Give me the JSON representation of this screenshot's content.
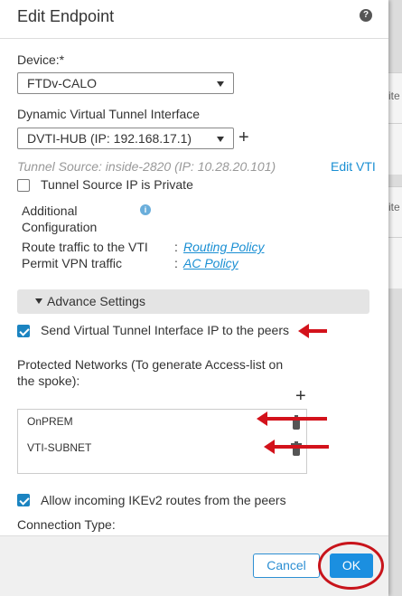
{
  "background": {
    "text_1": "ite",
    "text_2": "ite"
  },
  "dialog": {
    "title": "Edit Endpoint",
    "help_icon": "help-icon",
    "device": {
      "label": "Device:*",
      "value": "FTDv-CALO"
    },
    "dvti": {
      "label": "Dynamic Virtual Tunnel Interface",
      "value": "DVTI-HUB (IP: 192.168.17.1)"
    },
    "tunnel_source": "Tunnel Source: inside-2820 (IP: 10.28.20.101)",
    "edit_vti": "Edit VTI",
    "tunnel_private": {
      "label": "Tunnel Source IP is Private",
      "checked": false
    },
    "additional": {
      "title_line1": "Additional",
      "title_line2": "Configuration",
      "route_label": "Route traffic to the VTI",
      "route_sep": ":",
      "route_link": "Routing Policy",
      "permit_label": "Permit VPN traffic",
      "permit_sep": ":",
      "permit_link": "AC Policy"
    },
    "advance_settings": "Advance Settings",
    "send_vti_ip": {
      "label": "Send Virtual Tunnel Interface IP to the peers",
      "checked": true
    },
    "protected_networks": {
      "label_line1": "Protected Networks (To generate Access-list on",
      "label_line2": "the spoke):",
      "items": [
        "OnPREM",
        "VTI-SUBNET"
      ]
    },
    "allow_ikev2": {
      "label": "Allow incoming IKEv2 routes from the peers",
      "checked": true
    },
    "connection_type": "Connection Type:",
    "buttons": {
      "cancel": "Cancel",
      "ok": "OK"
    }
  },
  "colors": {
    "accent": "#1b8fe0",
    "annotation_red": "#d3121b",
    "link": "#1a8fd3"
  }
}
